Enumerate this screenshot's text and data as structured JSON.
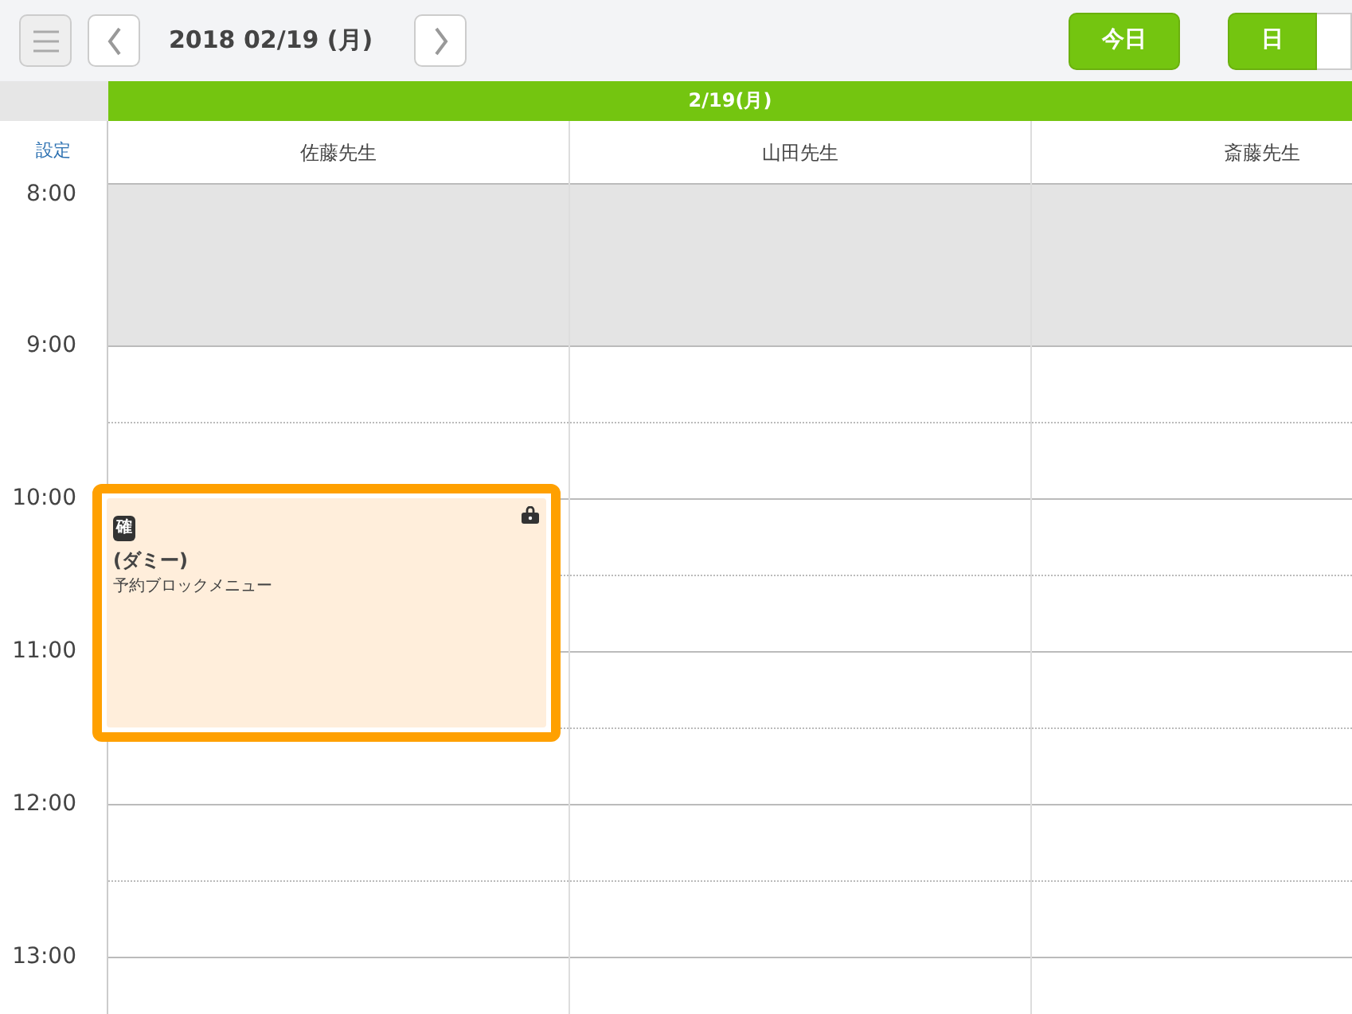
{
  "toolbar": {
    "date_title": "2018 02/19 (月)",
    "today_button": "今日",
    "view_buttons": [
      {
        "label": "日",
        "selected": true
      }
    ]
  },
  "date_bar": "2/19(月)",
  "settings_link": "設定",
  "staff": [
    "佐藤先生",
    "山田先生",
    "斎藤先生"
  ],
  "time_slots": [
    {
      "label": "8:00",
      "unavailable": true
    },
    {
      "label": "9:00",
      "unavailable": false
    },
    {
      "label": "10:00",
      "unavailable": false
    },
    {
      "label": "11:00",
      "unavailable": false
    },
    {
      "label": "12:00",
      "unavailable": false
    },
    {
      "label": "13:00",
      "unavailable": false
    }
  ],
  "event": {
    "badge": "確",
    "title": "(ダミー)",
    "menu": "予約ブロックメニュー",
    "locked": true,
    "selected": true
  }
}
